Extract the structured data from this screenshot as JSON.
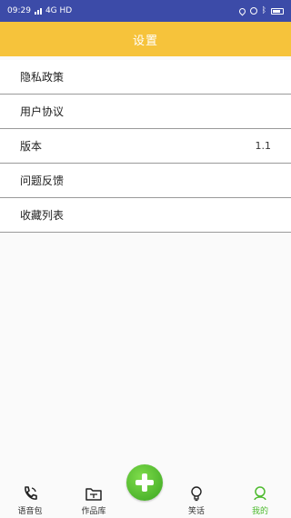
{
  "status_bar": {
    "time": "09:29",
    "network": "4G HD"
  },
  "header": {
    "title": "设置"
  },
  "settings_list": [
    {
      "label": "隐私政策",
      "value": ""
    },
    {
      "label": "用户协议",
      "value": ""
    },
    {
      "label": "版本",
      "value": "1.1"
    },
    {
      "label": "问题反馈",
      "value": ""
    },
    {
      "label": "收藏列表",
      "value": ""
    }
  ],
  "bottom_nav": {
    "voice_pack": "语音包",
    "works": "作品库",
    "jokes": "笑话",
    "mine": "我的"
  },
  "colors": {
    "status_bar": "#3c4ba8",
    "header": "#f6c33b",
    "add_button": "#4cba2d",
    "active_nav": "#4cba2d"
  }
}
